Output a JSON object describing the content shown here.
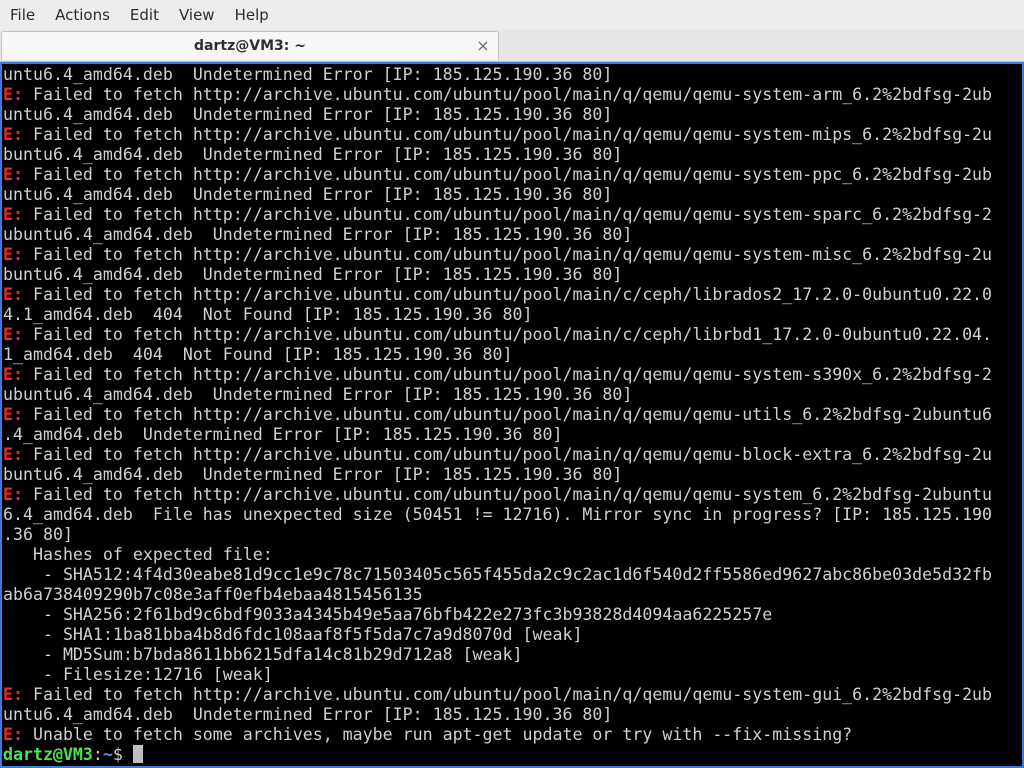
{
  "menubar": {
    "items": [
      "File",
      "Actions",
      "Edit",
      "View",
      "Help"
    ]
  },
  "tab": {
    "title": "dartz@VM3: ~",
    "close_glyph": "×"
  },
  "terminal": {
    "lines": [
      {
        "prefix": "",
        "text": "untu6.4_amd64.deb  Undetermined Error [IP: 185.125.190.36 80]"
      },
      {
        "prefix": "E:",
        "text": " Failed to fetch http://archive.ubuntu.com/ubuntu/pool/main/q/qemu/qemu-system-arm_6.2%2bdfsg-2ub"
      },
      {
        "prefix": "",
        "text": "untu6.4_amd64.deb  Undetermined Error [IP: 185.125.190.36 80]"
      },
      {
        "prefix": "E:",
        "text": " Failed to fetch http://archive.ubuntu.com/ubuntu/pool/main/q/qemu/qemu-system-mips_6.2%2bdfsg-2u"
      },
      {
        "prefix": "",
        "text": "buntu6.4_amd64.deb  Undetermined Error [IP: 185.125.190.36 80]"
      },
      {
        "prefix": "E:",
        "text": " Failed to fetch http://archive.ubuntu.com/ubuntu/pool/main/q/qemu/qemu-system-ppc_6.2%2bdfsg-2ub"
      },
      {
        "prefix": "",
        "text": "untu6.4_amd64.deb  Undetermined Error [IP: 185.125.190.36 80]"
      },
      {
        "prefix": "E:",
        "text": " Failed to fetch http://archive.ubuntu.com/ubuntu/pool/main/q/qemu/qemu-system-sparc_6.2%2bdfsg-2"
      },
      {
        "prefix": "",
        "text": "ubuntu6.4_amd64.deb  Undetermined Error [IP: 185.125.190.36 80]"
      },
      {
        "prefix": "E:",
        "text": " Failed to fetch http://archive.ubuntu.com/ubuntu/pool/main/q/qemu/qemu-system-misc_6.2%2bdfsg-2u"
      },
      {
        "prefix": "",
        "text": "buntu6.4_amd64.deb  Undetermined Error [IP: 185.125.190.36 80]"
      },
      {
        "prefix": "E:",
        "text": " Failed to fetch http://archive.ubuntu.com/ubuntu/pool/main/c/ceph/librados2_17.2.0-0ubuntu0.22.0"
      },
      {
        "prefix": "",
        "text": "4.1_amd64.deb  404  Not Found [IP: 185.125.190.36 80]"
      },
      {
        "prefix": "E:",
        "text": " Failed to fetch http://archive.ubuntu.com/ubuntu/pool/main/c/ceph/librbd1_17.2.0-0ubuntu0.22.04."
      },
      {
        "prefix": "",
        "text": "1_amd64.deb  404  Not Found [IP: 185.125.190.36 80]"
      },
      {
        "prefix": "E:",
        "text": " Failed to fetch http://archive.ubuntu.com/ubuntu/pool/main/q/qemu/qemu-system-s390x_6.2%2bdfsg-2"
      },
      {
        "prefix": "",
        "text": "ubuntu6.4_amd64.deb  Undetermined Error [IP: 185.125.190.36 80]"
      },
      {
        "prefix": "E:",
        "text": " Failed to fetch http://archive.ubuntu.com/ubuntu/pool/main/q/qemu/qemu-utils_6.2%2bdfsg-2ubuntu6"
      },
      {
        "prefix": "",
        "text": ".4_amd64.deb  Undetermined Error [IP: 185.125.190.36 80]"
      },
      {
        "prefix": "E:",
        "text": " Failed to fetch http://archive.ubuntu.com/ubuntu/pool/main/q/qemu/qemu-block-extra_6.2%2bdfsg-2u"
      },
      {
        "prefix": "",
        "text": "buntu6.4_amd64.deb  Undetermined Error [IP: 185.125.190.36 80]"
      },
      {
        "prefix": "E:",
        "text": " Failed to fetch http://archive.ubuntu.com/ubuntu/pool/main/q/qemu/qemu-system_6.2%2bdfsg-2ubuntu"
      },
      {
        "prefix": "",
        "text": "6.4_amd64.deb  File has unexpected size (50451 != 12716). Mirror sync in progress? [IP: 185.125.190"
      },
      {
        "prefix": "",
        "text": ".36 80]"
      },
      {
        "prefix": "",
        "text": "   Hashes of expected file:"
      },
      {
        "prefix": "",
        "text": "    - SHA512:4f4d30eabe81d9cc1e9c78c71503405c565f455da2c9c2ac1d6f540d2ff5586ed9627abc86be03de5d32fb"
      },
      {
        "prefix": "",
        "text": "ab6a738409290b7c08e3aff0efb4ebaa4815456135"
      },
      {
        "prefix": "",
        "text": "    - SHA256:2f61bd9c6bdf9033a4345b49e5aa76bfb422e273fc3b93828d4094aa6225257e"
      },
      {
        "prefix": "",
        "text": "    - SHA1:1ba81bba4b8d6fdc108aaf8f5f5da7c7a9d8070d [weak]"
      },
      {
        "prefix": "",
        "text": "    - MD5Sum:b7bda8611bb6215dfa14c81b29d712a8 [weak]"
      },
      {
        "prefix": "",
        "text": "    - Filesize:12716 [weak]"
      },
      {
        "prefix": "E:",
        "text": " Failed to fetch http://archive.ubuntu.com/ubuntu/pool/main/q/qemu/qemu-system-gui_6.2%2bdfsg-2ub"
      },
      {
        "prefix": "",
        "text": "untu6.4_amd64.deb  Undetermined Error [IP: 185.125.190.36 80]"
      },
      {
        "prefix": "E:",
        "text": " Unable to fetch some archives, maybe run apt-get update or try with --fix-missing?"
      }
    ],
    "prompt": {
      "user_host": "dartz@VM3",
      "separator": ":",
      "path": "~",
      "symbol": "$ "
    }
  },
  "colors": {
    "error_prefix": "#ef2929",
    "prompt_user": "#4ee34e",
    "prompt_path": "#5c8fe6",
    "terminal_bg": "#000000",
    "terminal_fg": "#d0d0d0",
    "focus_border": "#3a7bd5"
  },
  "icons": {
    "tab_close": "close-icon",
    "cursor": "block-cursor"
  }
}
